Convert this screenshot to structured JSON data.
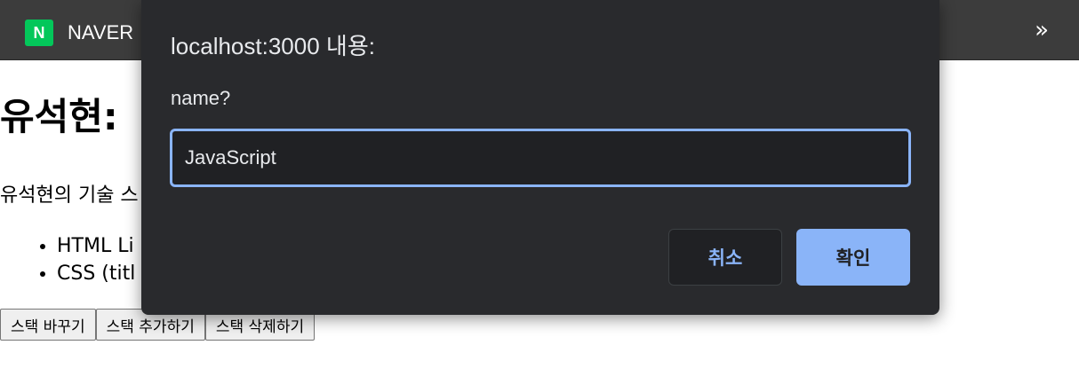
{
  "browser_toolbar": {
    "bookmark_logo_letter": "N",
    "bookmark_label": "NAVER",
    "more_bookmarks_icon": "»",
    "accent": "#03c75a"
  },
  "page": {
    "title": "유석현:",
    "intro": "유석현의 기술 스",
    "stack_items": [
      "HTML Li",
      "CSS (titl"
    ],
    "buttons": {
      "change": "스택 바꾸기",
      "add": "스택 추가하기",
      "delete": "스택 삭제하기"
    }
  },
  "prompt_dialog": {
    "title": "localhost:3000 내용:",
    "message": "name?",
    "input_value": "JavaScript",
    "cancel_label": "취소",
    "ok_label": "확인",
    "accent": "#8ab4f8",
    "background": "#292a2d"
  }
}
